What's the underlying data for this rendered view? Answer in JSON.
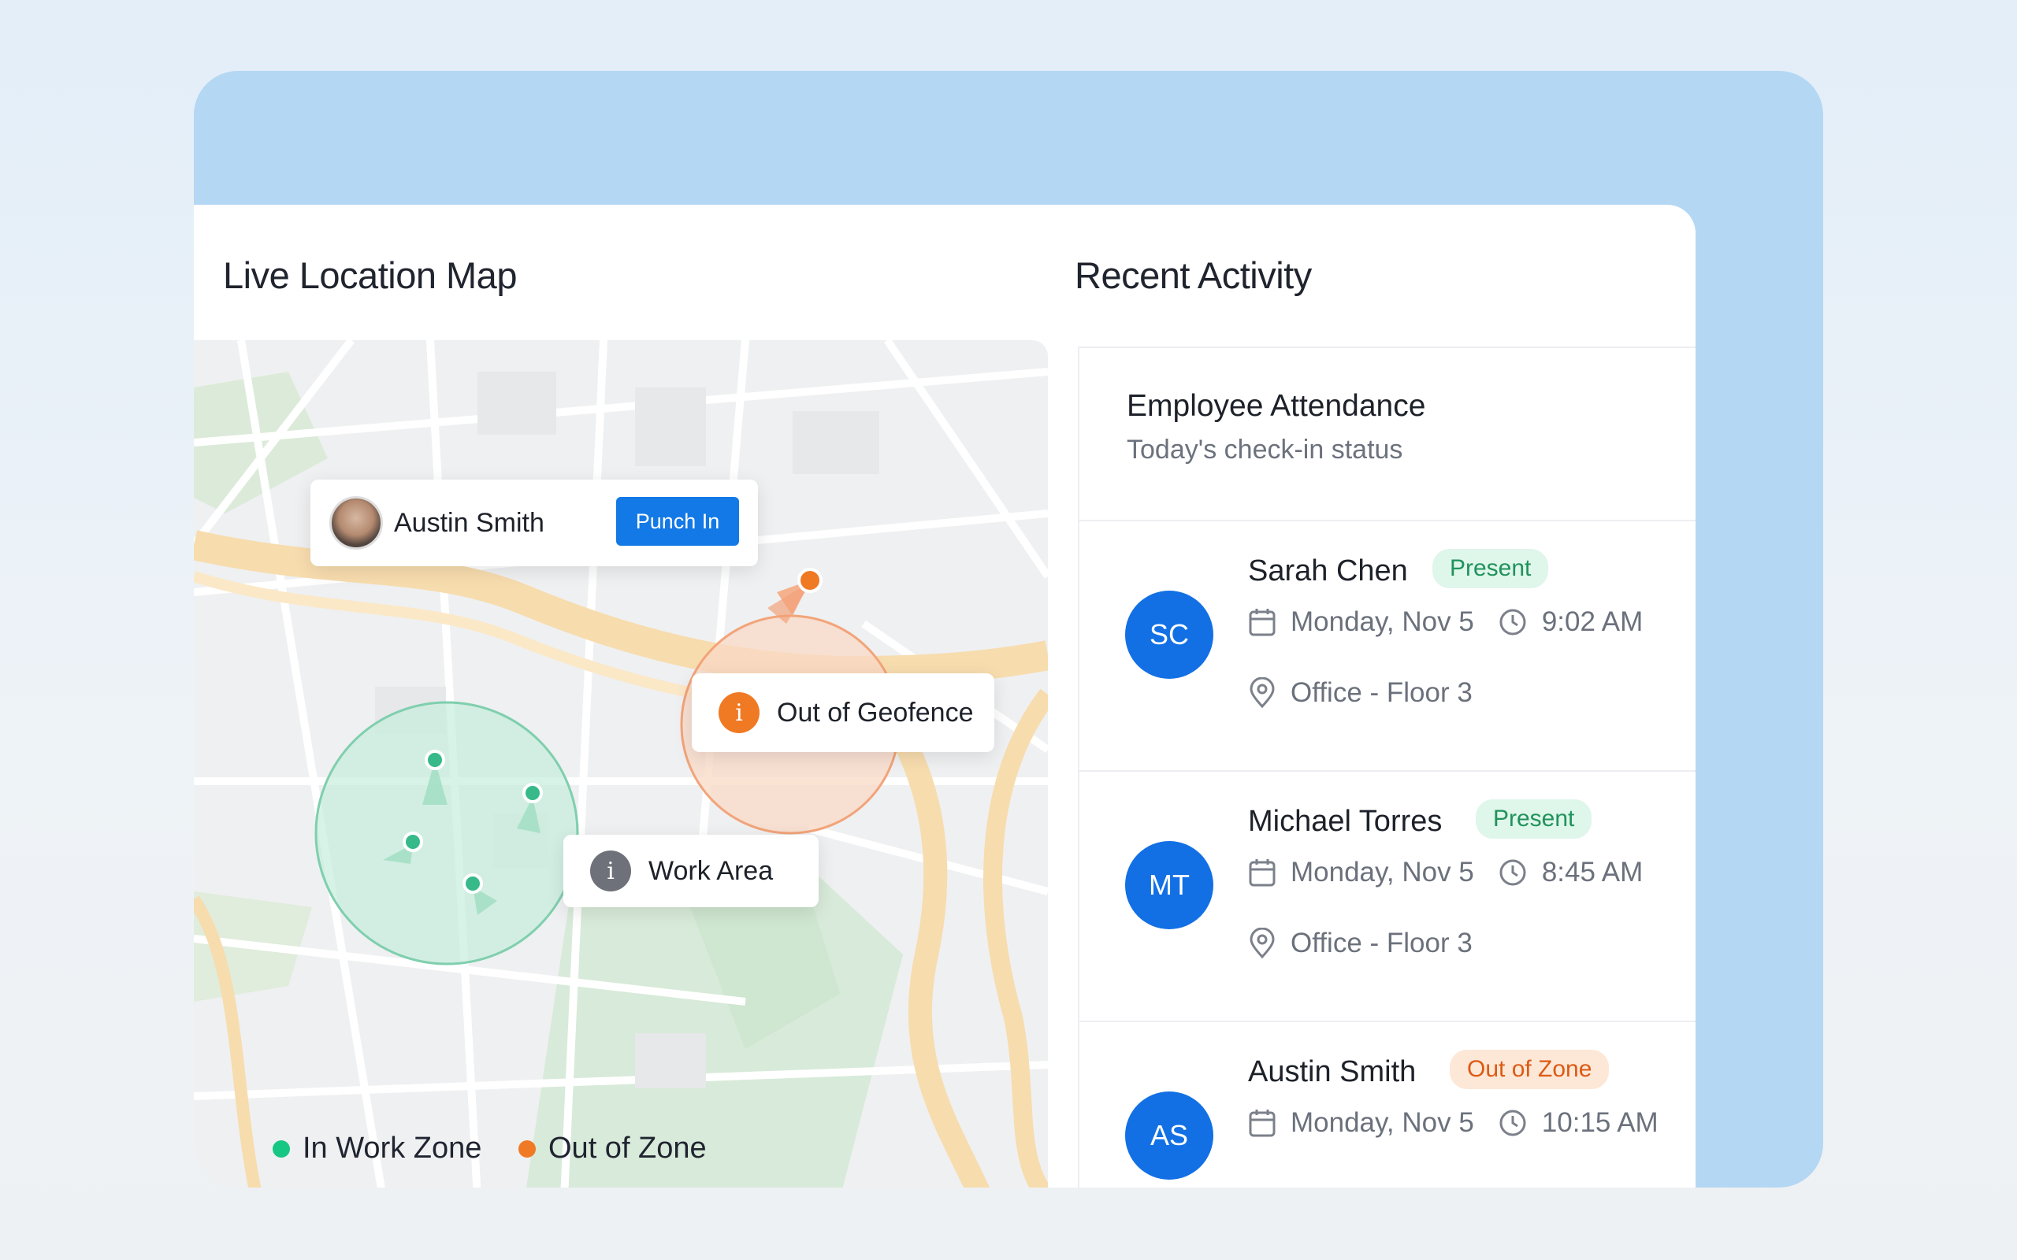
{
  "colors": {
    "accent_blue": "#1270e4",
    "in_zone_green": "#16c784",
    "out_zone_orange": "#f07a24",
    "present_bg": "#dff6ea",
    "present_fg": "#20925c",
    "outzone_bg": "#fde7d7",
    "outzone_fg": "#dc5a14"
  },
  "map_section": {
    "title": "Live Location Map",
    "employee_chip": {
      "name": "Austin Smith",
      "button": "Punch In"
    },
    "geofence_alert": {
      "icon": "info-icon",
      "label": "Out of Geofence"
    },
    "work_area_tag": {
      "icon": "info-icon",
      "label": "Work Area"
    },
    "legend": [
      {
        "label": "In Work Zone",
        "color": "#16c784"
      },
      {
        "label": "Out of Zone",
        "color": "#f07a24"
      }
    ]
  },
  "activity_section": {
    "title": "Recent Activity",
    "card_title": "Employee Attendance",
    "card_subtitle": "Today's check-in status",
    "entries": [
      {
        "initials": "SC",
        "name": "Sarah Chen",
        "status": "Present",
        "date": "Monday, Nov 5",
        "time": "9:02 AM",
        "location": "Office - Floor 3"
      },
      {
        "initials": "MT",
        "name": "Michael Torres",
        "status": "Present",
        "date": "Monday, Nov 5",
        "time": "8:45 AM",
        "location": "Office - Floor 3"
      },
      {
        "initials": "AS",
        "name": "Austin Smith",
        "status": "Out of Zone",
        "date": "Monday, Nov 5",
        "time": "10:15 AM",
        "location": ""
      }
    ]
  }
}
